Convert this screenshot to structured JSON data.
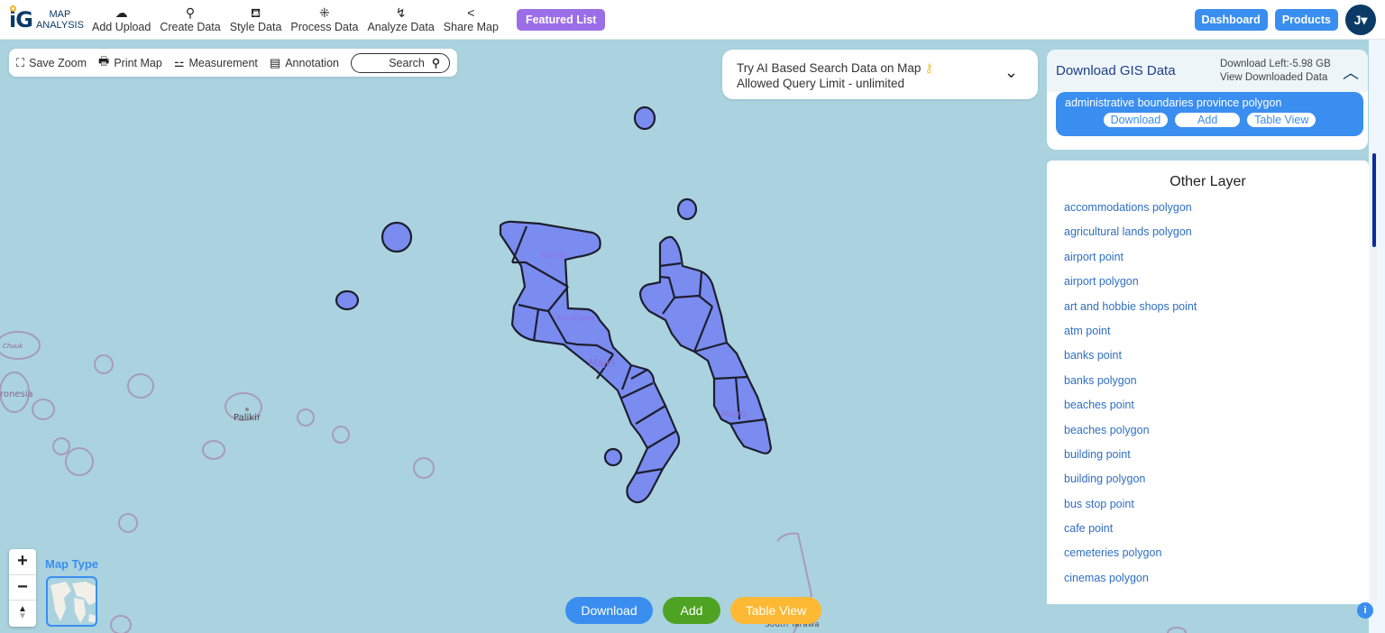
{
  "app": {
    "logo_top": "MAP",
    "logo_bottom": "ANALYSIS",
    "logo_mark": "iG"
  },
  "nav": [
    {
      "label": "Add Upload",
      "icon": "cloud-upload-icon",
      "glyph": "☁"
    },
    {
      "label": "Create Data",
      "icon": "map-pin-icon",
      "glyph": "⚲"
    },
    {
      "label": "Style Data",
      "icon": "paint-bucket-icon",
      "glyph": "⛾"
    },
    {
      "label": "Process Data",
      "icon": "process-icon",
      "glyph": "⁜"
    },
    {
      "label": "Analyze Data",
      "icon": "analyze-icon",
      "glyph": "↯"
    },
    {
      "label": "Share Map",
      "icon": "share-icon",
      "glyph": "<"
    }
  ],
  "featured_label": "Featured List",
  "topright": {
    "dashboard": "Dashboard",
    "products": "Products",
    "avatar_letter": "J▾"
  },
  "toolbox": {
    "save_zoom": "Save Zoom",
    "print_map": "Print Map",
    "measurement": "Measurement",
    "annotation": "Annotation",
    "search": "Search"
  },
  "ai_box": {
    "line1": "Try AI Based Search Data on Map",
    "line2": "Allowed Query Limit - unlimited"
  },
  "gis_panel": {
    "title": "Download GIS Data",
    "download_left": "Download Left:-5.98 GB",
    "view_downloaded": "View Downloaded Data",
    "layer_name": "administrative boundaries province polygon",
    "download": "Download",
    "add": "Add",
    "table_view": "Table View"
  },
  "other_layers": {
    "title": "Other Layer",
    "items": [
      "accommodations polygon",
      "agricultural lands polygon",
      "airport point",
      "airport polygon",
      "art and hobbie shops point",
      "atm point",
      "banks point",
      "banks polygon",
      "beaches point",
      "beaches polygon",
      "building point",
      "building polygon",
      "bus stop point",
      "cafe point",
      "cemeteries polygon",
      "cinemas polygon"
    ]
  },
  "map": {
    "labels": {
      "ronlap": "Roñlap",
      "kuwajleen": "Kuwajleen",
      "majel": "Majel",
      "majro": "Majro",
      "palikir": "Palikir",
      "chuuk": "Chuuk",
      "micronesia": "ronesia",
      "south_tarawa": "South Tarawa"
    },
    "polygon_fill": "#7a8cf0"
  },
  "map_type_label": "Map Type",
  "bottom": {
    "download": "Download",
    "add": "Add",
    "table_view": "Table View"
  },
  "info": "i"
}
